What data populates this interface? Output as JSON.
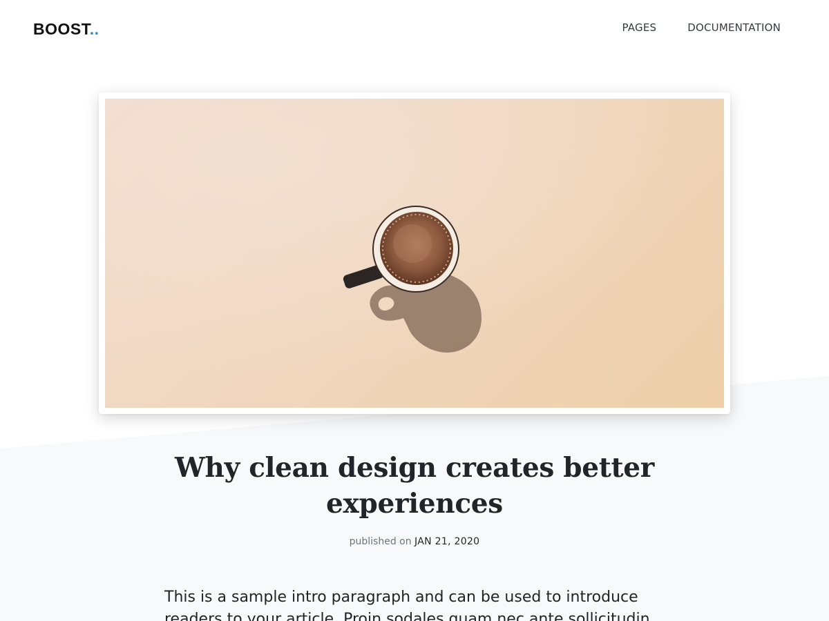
{
  "header": {
    "logo": {
      "text": "BOOST",
      "dots": ".."
    },
    "nav": {
      "pages_label": "PAGES",
      "documentation_label": "DOCUMENTATION"
    }
  },
  "hero": {
    "image_icon": "coffee-cup-photo"
  },
  "article": {
    "title": "Why clean design creates better experiences",
    "meta": {
      "published_label": "published on",
      "date": "JAN 21, 2020"
    },
    "intro": "This is a sample intro paragraph and can be used to introduce readers to your article. Proin sodales quam nec ante sollicitudin"
  },
  "colors": {
    "accent": "#1a8fd6",
    "page_background_lower": "#f8f9fa",
    "text": "#212529",
    "muted_text": "#6c757d"
  }
}
